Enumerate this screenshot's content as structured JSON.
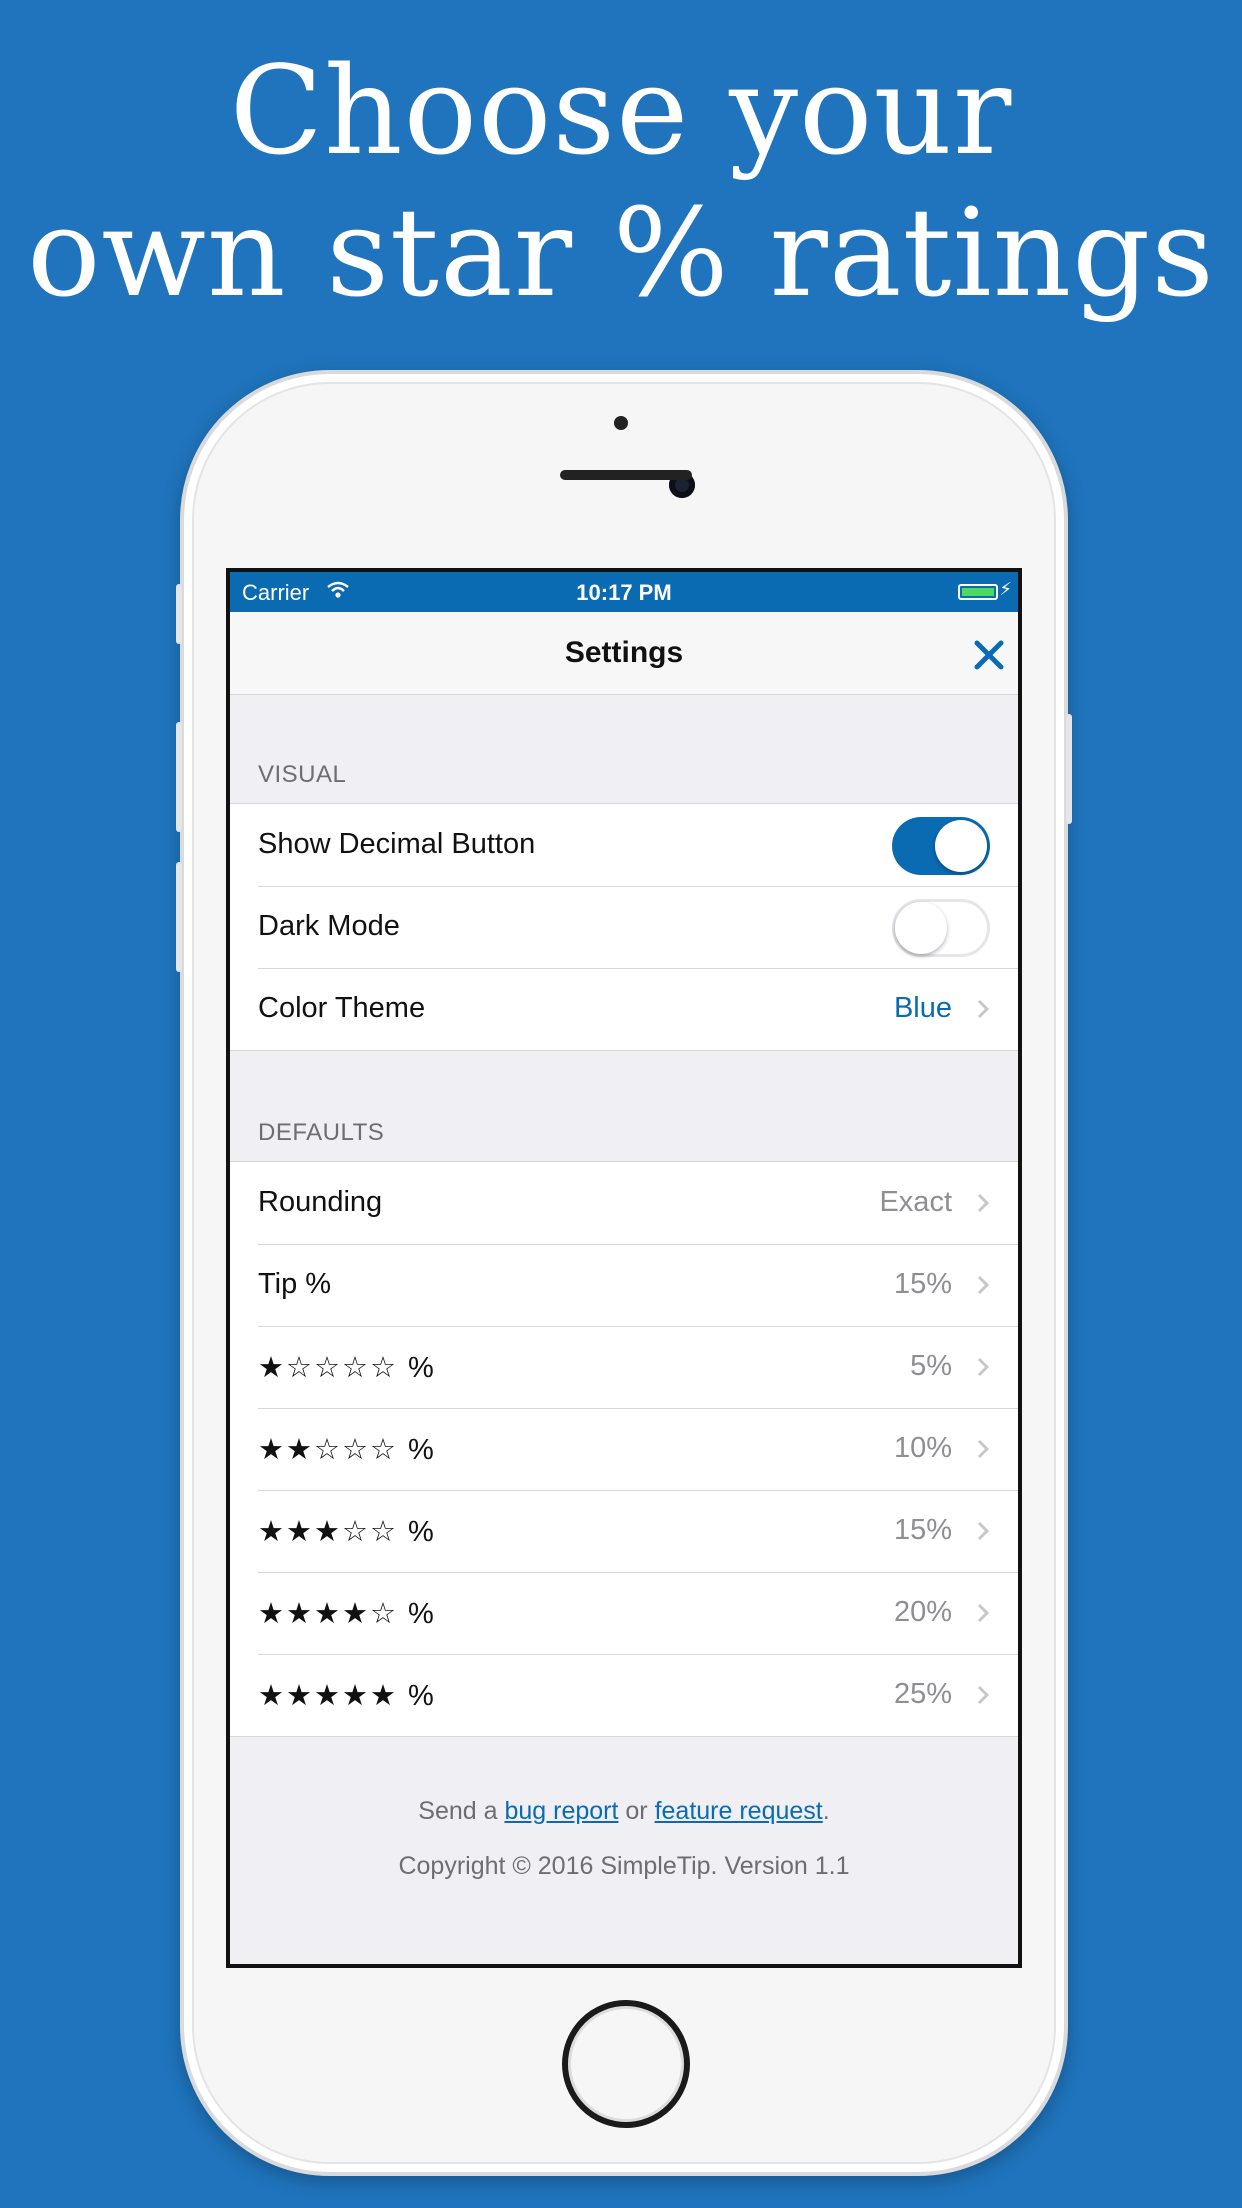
{
  "headline": {
    "line1": "Choose your",
    "line2": "own star % ratings"
  },
  "status_bar": {
    "carrier": "Carrier",
    "time": "10:17 PM",
    "wifi_icon": "wifi-icon",
    "battery_icon": "battery-charging-icon"
  },
  "nav": {
    "title": "Settings",
    "close_icon": "close-x-icon"
  },
  "visual": {
    "header": "VISUAL",
    "show_decimal_label": "Show Decimal Button",
    "show_decimal_on": true,
    "dark_mode_label": "Dark Mode",
    "dark_mode_on": false,
    "color_theme_label": "Color Theme",
    "color_theme_value": "Blue"
  },
  "defaults": {
    "header": "DEFAULTS",
    "rows": [
      {
        "label": "Rounding",
        "value": "Exact"
      },
      {
        "label": "Tip %",
        "value": "15%"
      },
      {
        "label": "★☆☆☆☆ %",
        "value": "5%"
      },
      {
        "label": "★★☆☆☆ %",
        "value": "10%"
      },
      {
        "label": "★★★☆☆ %",
        "value": "15%"
      },
      {
        "label": "★★★★☆ %",
        "value": "20%"
      },
      {
        "label": "★★★★★ %",
        "value": "25%"
      }
    ]
  },
  "footer": {
    "send_a": "Send a ",
    "bug_report": "bug report",
    "or": " or ",
    "feature_request": "feature request",
    "period": ".",
    "copyright": "Copyright © 2016 SimpleTip. Version 1.1"
  },
  "colors": {
    "background": "#1f74bd",
    "accent": "#0a6bb3"
  }
}
